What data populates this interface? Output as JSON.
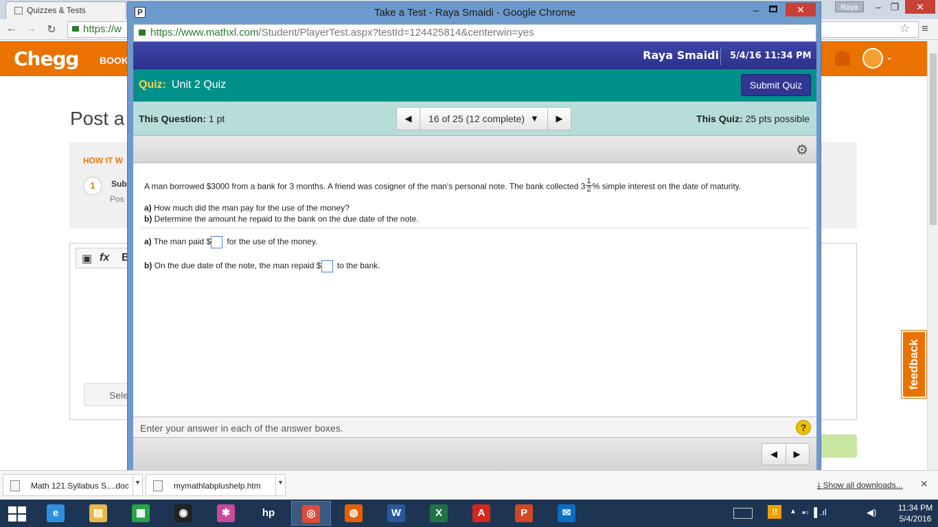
{
  "background": {
    "tab_title": "Quizzes & Tests",
    "omnibox_prefix": "https://w",
    "user_badge": "Raya",
    "chegg_logo": "Chegg",
    "chegg_nav": "BOOK",
    "post_title": "Post a",
    "how_it_works": "HOW IT W",
    "step_number": "1",
    "step_sub": "Sub",
    "step_pos": "Pos",
    "select_button": "Sele",
    "feedback_label": "feedback"
  },
  "popup": {
    "window_title": "Take a Test - Raya Smaidi - Google Chrome",
    "url_secure": "https://www.mathxl.com",
    "url_path": "/Student/PlayerTest.aspx?testId=124425814&centerwin=yes",
    "user_name": "Raya Smaidi",
    "datetime": "5/4/16 11:34 PM",
    "quiz_label": "Quiz:",
    "quiz_name": "Unit 2 Quiz",
    "submit_label": "Submit Quiz",
    "this_question_label": "This Question:",
    "this_question_value": "1 pt",
    "question_nav": "16 of 25 (12 complete)",
    "this_quiz_label": "This Quiz:",
    "this_quiz_value": "25 pts possible",
    "question": {
      "text_before": "A man borrowed $3000 from a bank for 3 months. A friend was cosigner of the man's personal note. The bank collected 3",
      "frac_num": "1",
      "frac_den": "2",
      "text_after": "% simple interest on the date of maturity.",
      "part_a_label": "a)",
      "part_a_text": "How much did the man pay for the use of the money?",
      "part_b_label": "b)",
      "part_b_text": "Determine the amount he repaid to the bank on the due date of the note."
    },
    "answers": {
      "a_label": "a)",
      "a_pre": "The man paid $",
      "a_value": "",
      "a_post": "for the use of the money.",
      "b_label": "b)",
      "b_pre": "On the due date of the note, the man repaid $",
      "b_value": "",
      "b_post": "to the bank."
    },
    "status_text": "Enter your answer in each of the answer boxes.",
    "help_label": "?"
  },
  "downloads": {
    "items": [
      {
        "name": "Math 121 Syllabus S....doc"
      },
      {
        "name": "mymathlabplushelp.htm"
      }
    ],
    "show_all": "Show all downloads..."
  },
  "taskbar": {
    "clock_time": "11:34 PM",
    "clock_date": "5/4/2016",
    "apps": [
      {
        "icon": "internet-explorer-icon",
        "glyph": "e",
        "color": "#2d8fe0"
      },
      {
        "icon": "file-explorer-icon",
        "glyph": "▤",
        "color": "#e8b84a"
      },
      {
        "icon": "store-icon",
        "glyph": "▦",
        "color": "#2aa24a"
      },
      {
        "icon": "media-icon",
        "glyph": "◉",
        "color": "#222222"
      },
      {
        "icon": "photos-icon",
        "glyph": "✱",
        "color": "#c84a9a"
      },
      {
        "icon": "hp-icon",
        "glyph": "hp",
        "color": "#1d3552"
      },
      {
        "icon": "chrome-icon",
        "glyph": "◎",
        "color": "#dd4b39"
      },
      {
        "icon": "firefox-icon",
        "glyph": "◍",
        "color": "#e66000"
      },
      {
        "icon": "word-icon",
        "glyph": "W",
        "color": "#2b579a"
      },
      {
        "icon": "excel-icon",
        "glyph": "X",
        "color": "#217346"
      },
      {
        "icon": "acrobat-icon",
        "glyph": "A",
        "color": "#d4261d"
      },
      {
        "icon": "powerpoint-icon",
        "glyph": "P",
        "color": "#d24726"
      },
      {
        "icon": "mail-icon",
        "glyph": "✉",
        "color": "#0a6fc2"
      }
    ]
  }
}
